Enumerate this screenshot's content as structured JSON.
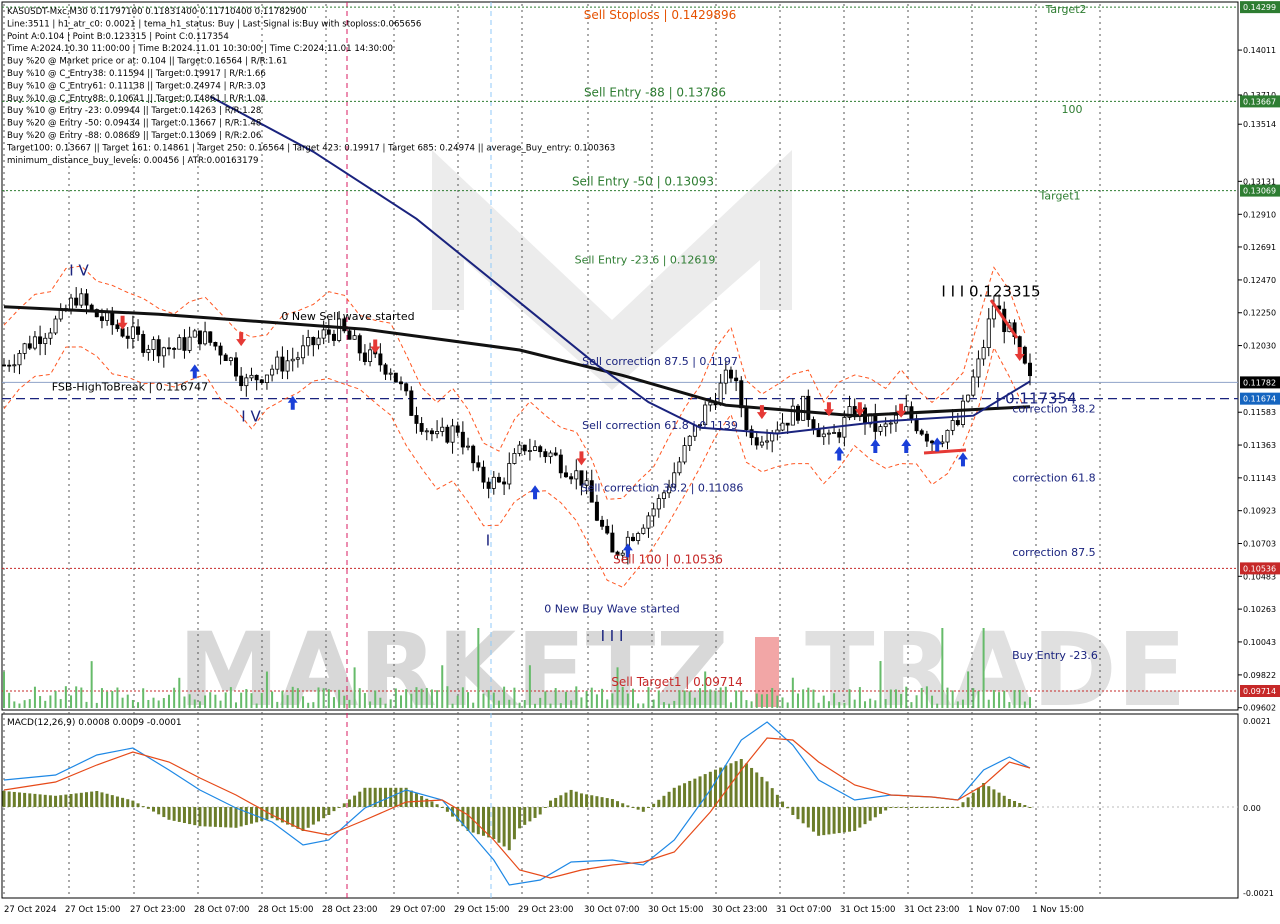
{
  "header_lines": [
    "KASUSDT-Mxc,M30  0.11797100 0.11831400 0.11710400 0.11782900",
    "Line:3511 | h1_atr_c0: 0.0021 | tema_h1_status: Buy | Last Signal is:Buy with stoploss:0.065656",
    "Point A:0.104 | Point B:0.123315 | Point C:0.117354",
    "Time A:2024.10.30 11:00:00 | Time B:2024.11.01 10:30:00 | Time C:2024.11.01 14:30:00",
    "Buy %20 @ Market price or at: 0.104 || Target:0.16564 | R/R:1.61",
    "Buy %10 @ C_Entry38: 0.11594 || Target:0.19917 | R/R:1.66",
    "Buy %10 @ C_Entry61: 0.11138 || Target:0.24974 | R/R:3.03",
    "Buy %10 @ C_Entry88: 0.10641 || Target:0.14861 | R/R:1.04",
    "Buy %10 @ Entry -23: 0.09944 || Target:0.14263 | R/R:1.28",
    "Buy %20 @ Entry -50: 0.09434 || Target:0.13667 | R/R:1.48",
    "Buy %20 @ Entry -88: 0.08689 || Target:0.13069 | R/R:2.06",
    "Target100: 0.13667 || Target 161: 0.14861 | Target 250: 0.16564 | Target 423: 0.19917 | Target 685: 0.24974 || average_Buy_entry: 0.100363",
    "minimum_distance_buy_levels: 0.00456 | ATR:0.00163179"
  ],
  "h_levels": [
    {
      "label": "Sell Stoploss | 0.1429896",
      "price": 0.14299,
      "color": "#2e7d32",
      "label_color": "#e65100",
      "style": "dotted",
      "label_x": 660
    },
    {
      "label": "Sell Entry -88 | 0.13786",
      "price": 0.13667,
      "color": "#2e7d32",
      "label_color": "#2e7d32",
      "style": "dotted",
      "label_x": 655
    },
    {
      "label": "Sell Entry -50 | 0.13093",
      "price": 0.13069,
      "color": "#2e7d32",
      "label_color": "#2e7d32",
      "style": "dotted",
      "label_x": 643
    },
    {
      "label": "Sell 100 | 0.10536",
      "price": 0.10536,
      "color": "#c62828",
      "label_color": "#c62828",
      "style": "dotted",
      "label_x": 668
    },
    {
      "label": "Sell Target1 | 0.09714",
      "price": 0.09714,
      "color": "#c62828",
      "label_color": "#c62828",
      "style": "dotted",
      "label_x": 677
    }
  ],
  "float_labels": [
    {
      "text": "Target2",
      "price": 0.1426,
      "x": 1066,
      "color": "#2e7d32"
    },
    {
      "text": "100",
      "price": 0.1359,
      "x": 1072,
      "color": "#2e7d32"
    },
    {
      "text": "Target1",
      "price": 0.1301,
      "x": 1060,
      "color": "#2e7d32"
    },
    {
      "text": "Sell Entry -23.6 | 0.12619",
      "price": 0.1258,
      "x": 645,
      "color": "#2e7d32"
    },
    {
      "text": "I I I 0.123315",
      "price": 0.1236,
      "x": 991,
      "color": "#000000"
    },
    {
      "text": "0 New Sell wave started",
      "price": 0.122,
      "x": 348,
      "color": "#000000"
    },
    {
      "text": "Sell correction 87.5 | 0.1197",
      "price": 0.119,
      "x": 660,
      "color": "#1a237e"
    },
    {
      "text": "| 0.117354",
      "price": 0.1164,
      "x": 1036,
      "color": "#1a237e"
    },
    {
      "text": "correction 38.2",
      "price": 0.1158,
      "x": 1054,
      "color": "#1a237e"
    },
    {
      "text": "Sell correction 61.8 | 0.1139",
      "price": 0.1147,
      "x": 660,
      "color": "#1a237e"
    },
    {
      "text": "Sell correction 38.2 | 0.11086",
      "price": 0.1105,
      "x": 662,
      "color": "#1a237e"
    },
    {
      "text": "correction 61.8",
      "price": 0.1112,
      "x": 1054,
      "color": "#1a237e"
    },
    {
      "text": "correction 87.5",
      "price": 0.1062,
      "x": 1054,
      "color": "#1a237e"
    },
    {
      "text": "0 New Buy Wave started",
      "price": 0.1024,
      "x": 612,
      "color": "#1a237e"
    },
    {
      "text": "Buy Entry -23.6",
      "price": 0.0993,
      "x": 1055,
      "color": "#1a237e"
    },
    {
      "text": "FSB-HighToBreak | 0.116747",
      "price": 0.1173,
      "x": 130,
      "color": "#000000"
    }
  ],
  "wave_marks": [
    {
      "text": "I V",
      "price": 0.125,
      "x": 79
    },
    {
      "text": "I V",
      "price": 0.1152,
      "x": 251
    },
    {
      "text": "I",
      "price": 0.1069,
      "x": 488
    },
    {
      "text": "I I I",
      "price": 0.1005,
      "x": 612
    }
  ],
  "price_axis": {
    "ticks": [
      "0.14011",
      "0.13710",
      "0.13514",
      "0.13131",
      "0.12910",
      "0.12691",
      "0.12470",
      "0.12250",
      "0.12030",
      "0.11583",
      "0.11363",
      "0.11143",
      "0.10923",
      "0.10703",
      "0.10483",
      "0.10263",
      "0.10043",
      "0.09822",
      "0.09602"
    ],
    "badges": [
      {
        "text": "0.14299",
        "price": 0.14299,
        "bg": "#2e7d32"
      },
      {
        "text": "0.13667",
        "price": 0.13667,
        "bg": "#2e7d32"
      },
      {
        "text": "0.13069",
        "price": 0.13069,
        "bg": "#2e7d32"
      },
      {
        "text": "0.11782",
        "price": 0.11783,
        "bg": "#000000"
      },
      {
        "text": "0.11674",
        "price": 0.11674,
        "bg": "#1565c0"
      },
      {
        "text": "0.10536",
        "price": 0.10536,
        "bg": "#c62828"
      },
      {
        "text": "0.09714",
        "price": 0.09714,
        "bg": "#c62828"
      }
    ]
  },
  "time_axis": [
    "27 Oct 2024",
    "27 Oct 15:00",
    "27 Oct 23:00",
    "28 Oct 07:00",
    "28 Oct 15:00",
    "28 Oct 23:00",
    "29 Oct 07:00",
    "29 Oct 15:00",
    "29 Oct 23:00",
    "30 Oct 07:00",
    "30 Oct 15:00",
    "30 Oct 23:00",
    "31 Oct 07:00",
    "31 Oct 15:00",
    "31 Oct 23:00",
    "1 Nov 07:00",
    "1 Nov 15:00"
  ],
  "macd": {
    "title": "MACD(12,26,9) 0.0008 0.0009 -0.0001",
    "ticks": [
      "0.0021",
      "0.00",
      "-0.0021"
    ]
  },
  "watermark": {
    "part1": "MARKETZ",
    "part2": "TRADE",
    "accent": "#e53935"
  },
  "chart_data": {
    "type": "line",
    "title": "KASUSDT-Mxc,M30",
    "x_range": [
      "27 Oct 2024",
      "1 Nov 15:00"
    ],
    "y_range": [
      0.096,
      0.1432
    ],
    "price_path": [
      {
        "t": 0,
        "p": 0.119
      },
      {
        "t": 6,
        "p": 0.1208
      },
      {
        "t": 11,
        "p": 0.1221
      },
      {
        "t": 14,
        "p": 0.1236
      },
      {
        "t": 17,
        "p": 0.1225
      },
      {
        "t": 22,
        "p": 0.1215
      },
      {
        "t": 27,
        "p": 0.1205
      },
      {
        "t": 33,
        "p": 0.1201
      },
      {
        "t": 38,
        "p": 0.121
      },
      {
        "t": 43,
        "p": 0.1198
      },
      {
        "t": 47,
        "p": 0.1178
      },
      {
        "t": 52,
        "p": 0.1188
      },
      {
        "t": 57,
        "p": 0.1196
      },
      {
        "t": 62,
        "p": 0.121
      },
      {
        "t": 65,
        "p": 0.1214
      },
      {
        "t": 70,
        "p": 0.1196
      },
      {
        "t": 75,
        "p": 0.1188
      },
      {
        "t": 79,
        "p": 0.116
      },
      {
        "t": 84,
        "p": 0.114
      },
      {
        "t": 88,
        "p": 0.1148
      },
      {
        "t": 92,
        "p": 0.1115
      },
      {
        "t": 96,
        "p": 0.111
      },
      {
        "t": 101,
        "p": 0.1136
      },
      {
        "t": 106,
        "p": 0.113
      },
      {
        "t": 112,
        "p": 0.1114
      },
      {
        "t": 116,
        "p": 0.108
      },
      {
        "t": 118,
        "p": 0.1062
      },
      {
        "t": 122,
        "p": 0.1078
      },
      {
        "t": 127,
        "p": 0.1098
      },
      {
        "t": 131,
        "p": 0.1125
      },
      {
        "t": 136,
        "p": 0.116
      },
      {
        "t": 141,
        "p": 0.1185
      },
      {
        "t": 145,
        "p": 0.114
      },
      {
        "t": 150,
        "p": 0.115
      },
      {
        "t": 155,
        "p": 0.1162
      },
      {
        "t": 160,
        "p": 0.1138
      },
      {
        "t": 165,
        "p": 0.116
      },
      {
        "t": 170,
        "p": 0.1145
      },
      {
        "t": 175,
        "p": 0.1158
      },
      {
        "t": 180,
        "p": 0.114
      },
      {
        "t": 185,
        "p": 0.115
      },
      {
        "t": 189,
        "p": 0.119
      },
      {
        "t": 192,
        "p": 0.1231
      },
      {
        "t": 196,
        "p": 0.1205
      },
      {
        "t": 199,
        "p": 0.1178
      }
    ],
    "series": [
      {
        "name": "MACD(12,26,9)",
        "values": [
          0.0008
        ]
      },
      {
        "name": "Signal",
        "values": [
          0.0009
        ]
      },
      {
        "name": "Histogram",
        "values": [
          -0.0001
        ]
      }
    ]
  }
}
